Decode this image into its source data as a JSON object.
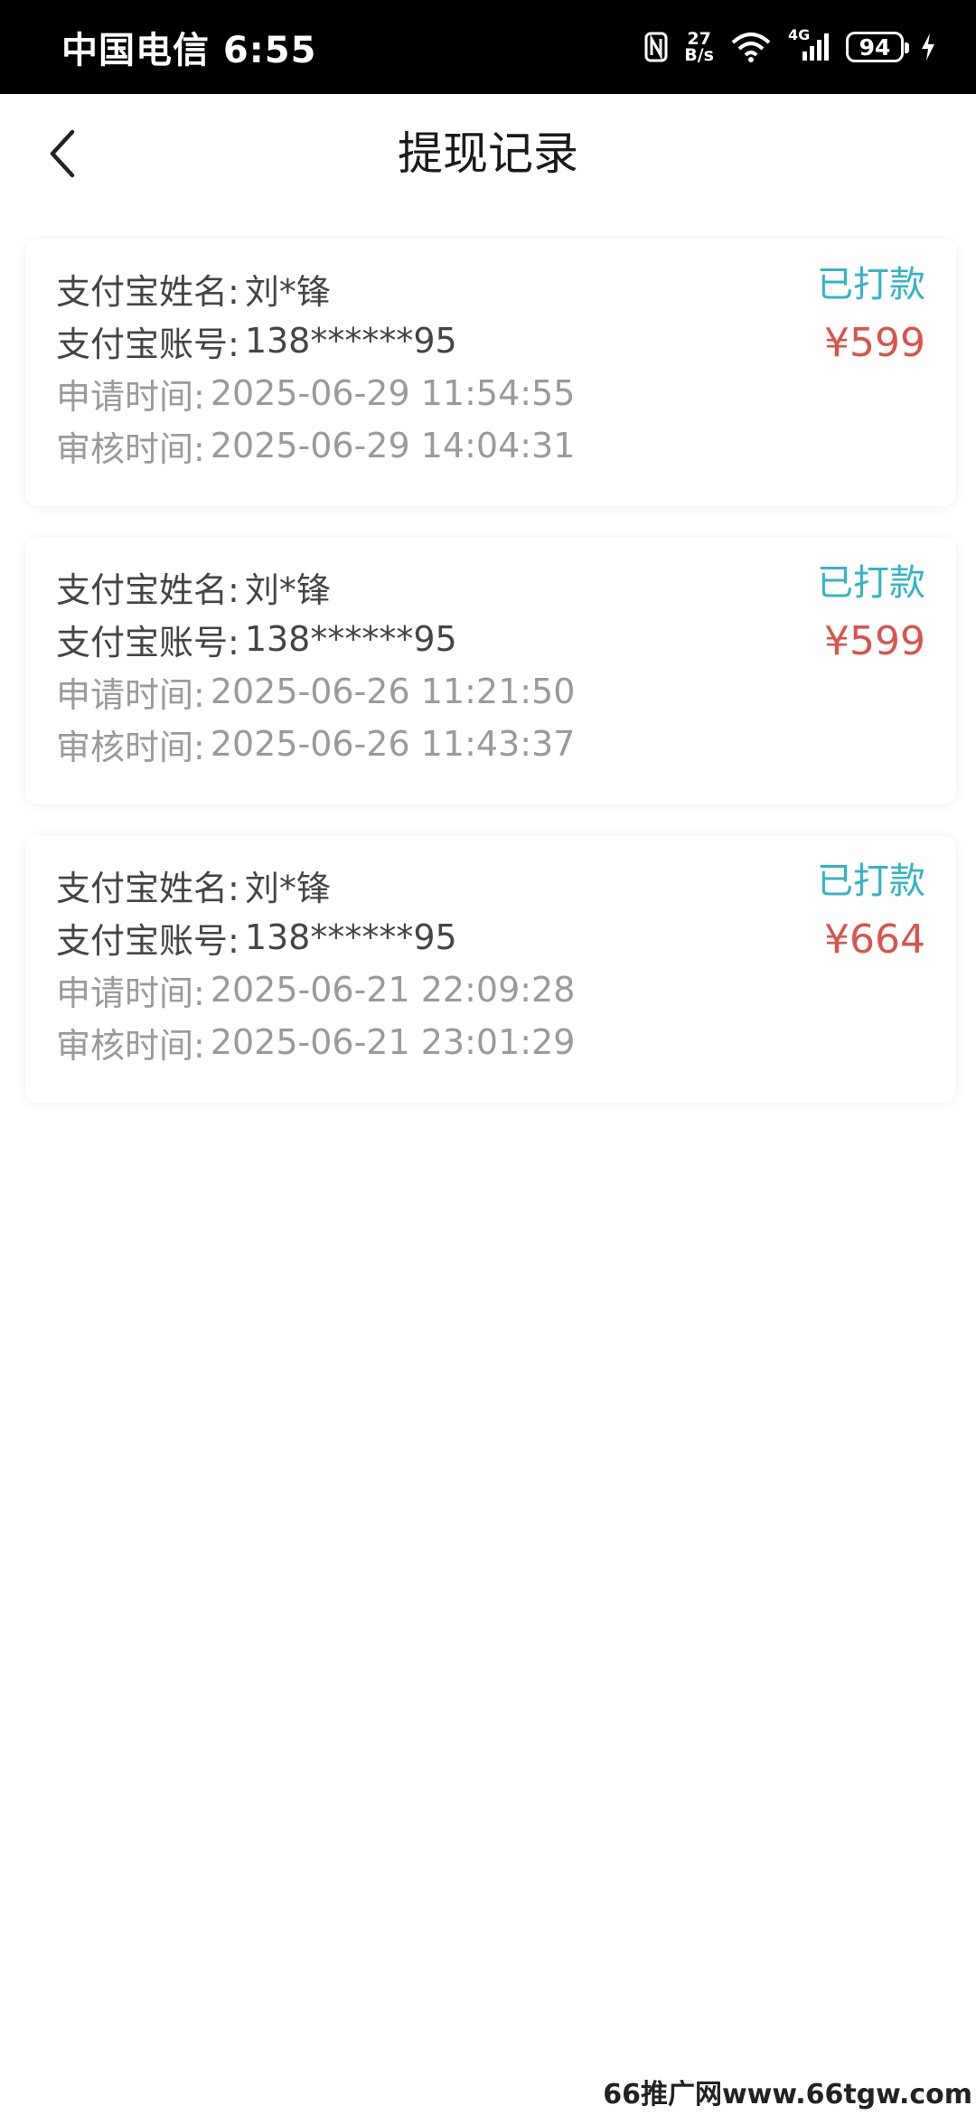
{
  "status_bar": {
    "carrier_time": "中国电信 6:55",
    "speed_top": "27",
    "speed_bottom": "B/s",
    "network": "4G",
    "battery": "94"
  },
  "header": {
    "title": "提现记录"
  },
  "records": [
    {
      "name_label": "支付宝姓名:",
      "name": "刘*锋",
      "account_label": "支付宝账号:",
      "account": "138******95",
      "apply_label": "申请时间:",
      "apply_time": "2025-06-29 11:54:55",
      "review_label": "审核时间:",
      "review_time": "2025-06-29 14:04:31",
      "status": "已打款",
      "amount": "¥599"
    },
    {
      "name_label": "支付宝姓名:",
      "name": "刘*锋",
      "account_label": "支付宝账号:",
      "account": "138******95",
      "apply_label": "申请时间:",
      "apply_time": "2025-06-26 11:21:50",
      "review_label": "审核时间:",
      "review_time": "2025-06-26 11:43:37",
      "status": "已打款",
      "amount": "¥599"
    },
    {
      "name_label": "支付宝姓名:",
      "name": "刘*锋",
      "account_label": "支付宝账号:",
      "account": "138******95",
      "apply_label": "申请时间:",
      "apply_time": "2025-06-21 22:09:28",
      "review_label": "审核时间:",
      "review_time": "2025-06-21 23:01:29",
      "status": "已打款",
      "amount": "¥664"
    }
  ],
  "watermark": "66推广网www.66tgw.com",
  "colors": {
    "status_paid": "#34b4c4",
    "amount": "#d9534f",
    "status_bar_bg": "#000000"
  }
}
